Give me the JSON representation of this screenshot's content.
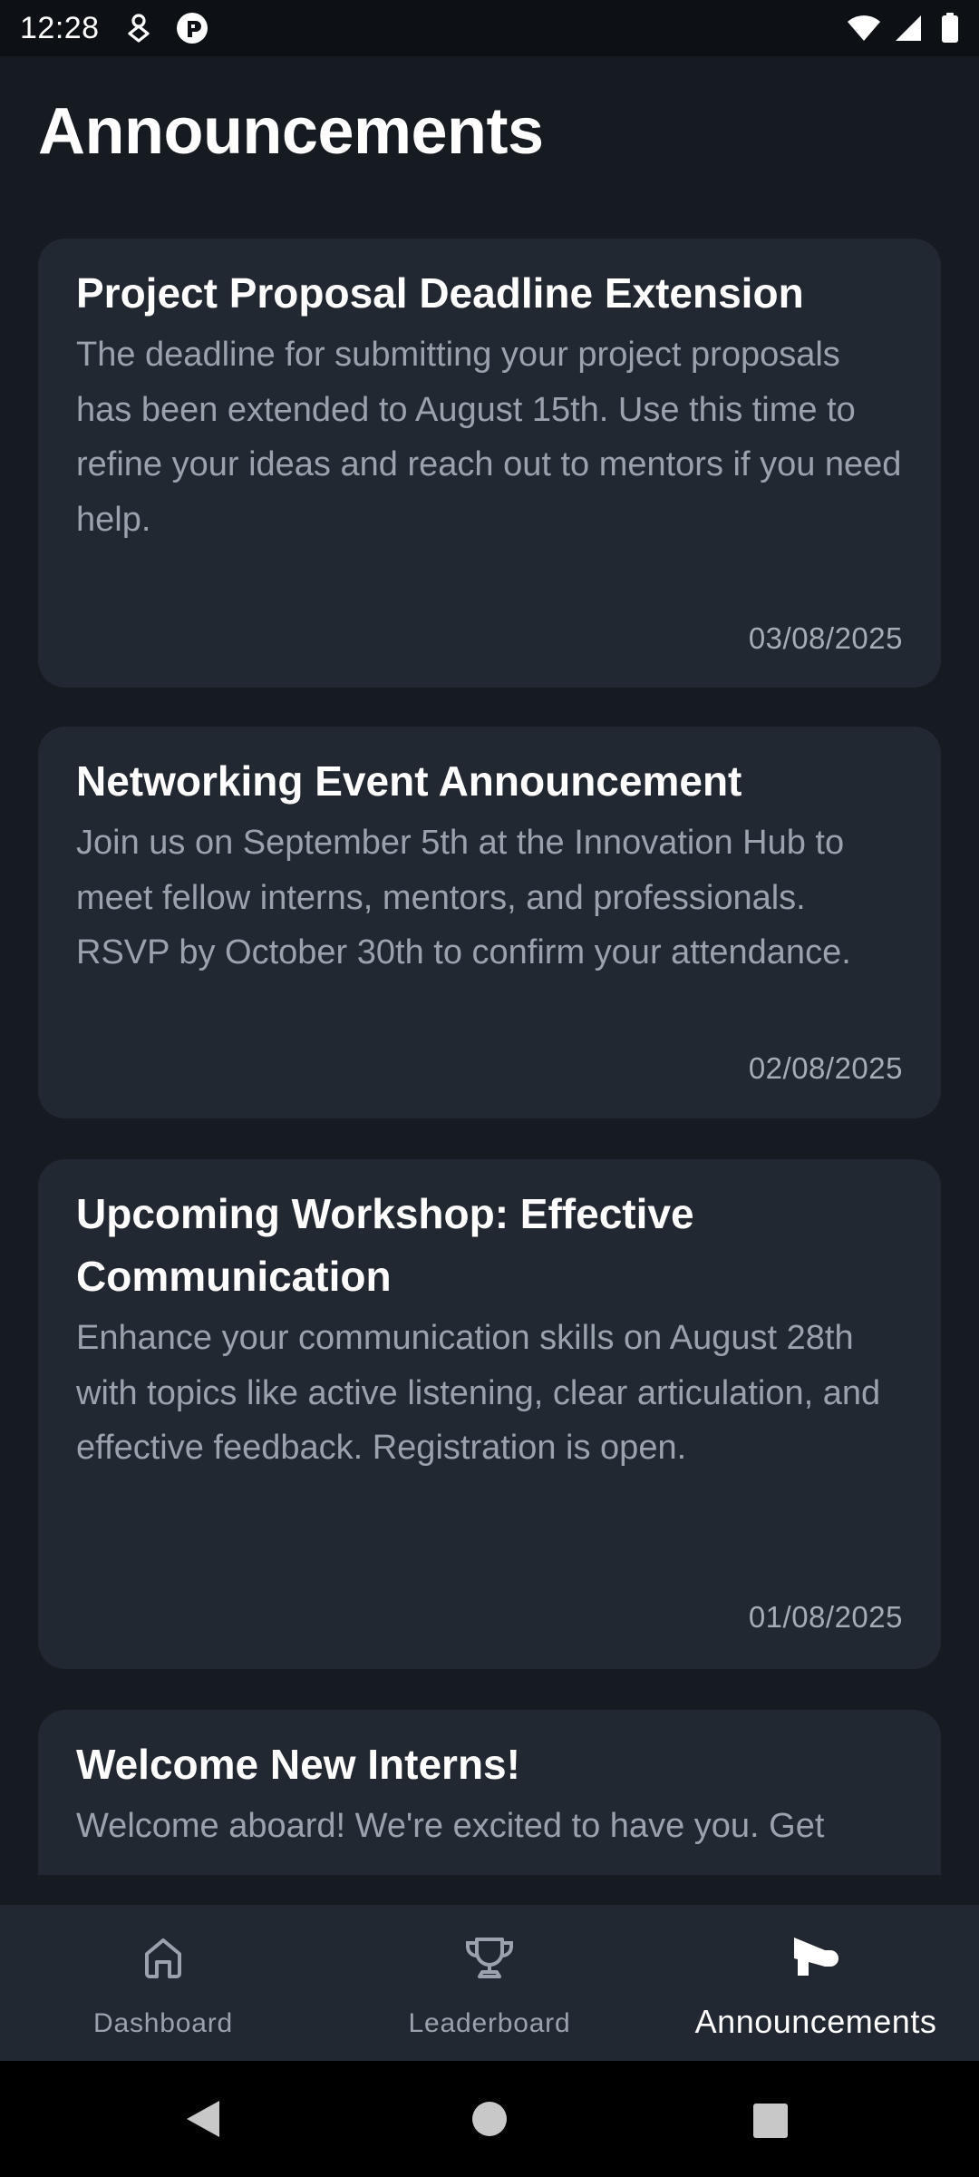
{
  "status_bar": {
    "time": "12:28"
  },
  "header": {
    "title": "Announcements"
  },
  "announcements": [
    {
      "title": "Project Proposal Deadline Extension",
      "body": "The deadline for submitting your project proposals has been extended to August 15th. Use this time to refine your ideas and reach out to mentors if you need help.",
      "date": "03/08/2025"
    },
    {
      "title": "Networking Event Announcement",
      "body": "Join us on September 5th at the Innovation Hub to meet fellow interns, mentors, and professionals. RSVP by October 30th to confirm your attendance.",
      "date": "02/08/2025"
    },
    {
      "title": "Upcoming Workshop: Effective Communication",
      "body": "Enhance your communication skills on August 28th with topics like active listening, clear articulation, and effective feedback. Registration is open.",
      "date": "01/08/2025"
    },
    {
      "title": "Welcome New Interns!",
      "body": "Welcome aboard! We're excited to have you. Get"
    }
  ],
  "bottom_nav": {
    "items": [
      {
        "label": "Dashboard",
        "icon": "home-icon"
      },
      {
        "label": "Leaderboard",
        "icon": "trophy-icon"
      },
      {
        "label": "Announcements",
        "icon": "megaphone-icon"
      }
    ],
    "active_index": 2
  },
  "colors": {
    "background": "#161b22",
    "card": "#222831",
    "title_text": "#ffffff",
    "body_text": "#9aa3ad"
  }
}
